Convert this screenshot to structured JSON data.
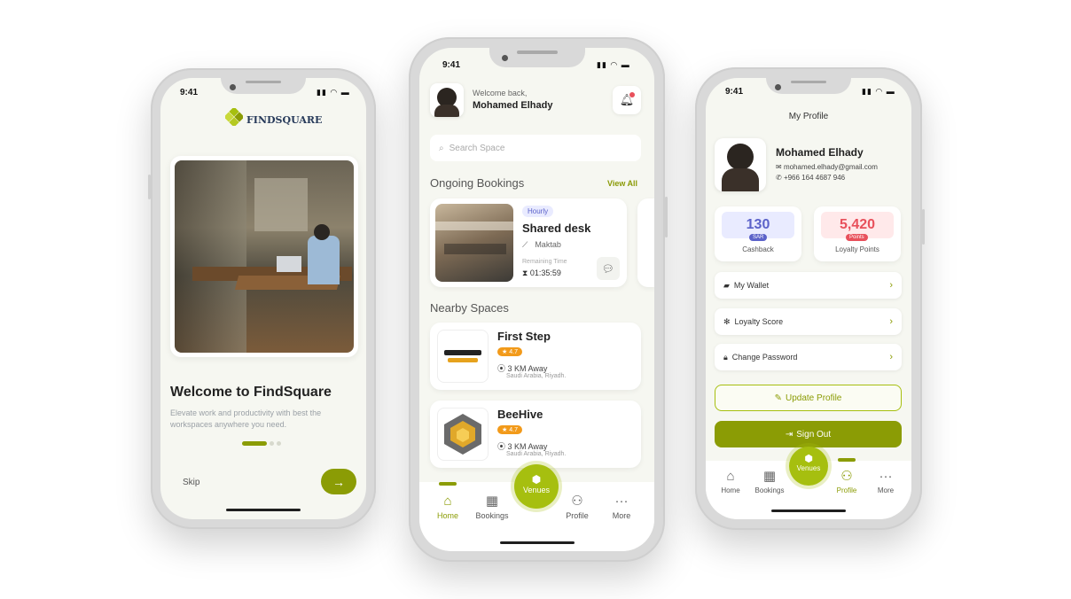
{
  "phone1": {
    "time": "9:41",
    "brand": "FINDSQUARE",
    "title": "Welcome to FindSquare",
    "subtitle": "Elevate work and productivity with best the workspaces anywhere you need.",
    "skip": "Skip",
    "next_icon": "arrow-right-icon"
  },
  "phone2": {
    "time": "9:41",
    "welcome": "Welcome back,",
    "user": "Mohamed Elhady",
    "search_placeholder": "Search Space",
    "ongoing_title": "Ongoing Bookings",
    "view_all": "View All",
    "booking": {
      "badge": "Hourly",
      "title": "Shared desk",
      "venue": "Maktab",
      "remaining_label": "Remaining Time",
      "remaining": "01:35:59"
    },
    "nearby_title": "Nearby Spaces",
    "spaces": [
      {
        "name": "First Step",
        "rating": "4.7",
        "distance": "3 KM Away",
        "location": "Saudi Arabia, Riyadh."
      },
      {
        "name": "BeeHive",
        "rating": "4.7",
        "distance": "3 KM Away",
        "location": "Saudi Arabia, Riyadh."
      }
    ],
    "nav": {
      "home": "Home",
      "bookings": "Bookings",
      "venues": "Venues",
      "profile": "Profile",
      "more": "More"
    }
  },
  "phone3": {
    "time": "9:41",
    "header": "My Profile",
    "name": "Mohamed Elhady",
    "email": "mohamed.elhady@gmail.com",
    "phone": "+966 164 4687 946",
    "cashback": {
      "value": "130",
      "unit": "SAR",
      "label": "Cashback"
    },
    "points": {
      "value": "5,420",
      "unit": "Points",
      "label": "Loyalty Points"
    },
    "menu": [
      "My Wallet",
      "Loyalty Score",
      "Change Password"
    ],
    "update": "Update Profile",
    "signout": "Sign Out",
    "nav": {
      "home": "Home",
      "bookings": "Bookings",
      "venues": "Venues",
      "profile": "Profile",
      "more": "More"
    }
  },
  "colors": {
    "accent": "#8b9c05",
    "venues": "#a6bf0f",
    "rating": "#f29a1a",
    "points": "#e8505b",
    "cashback": "#5b62c9"
  }
}
